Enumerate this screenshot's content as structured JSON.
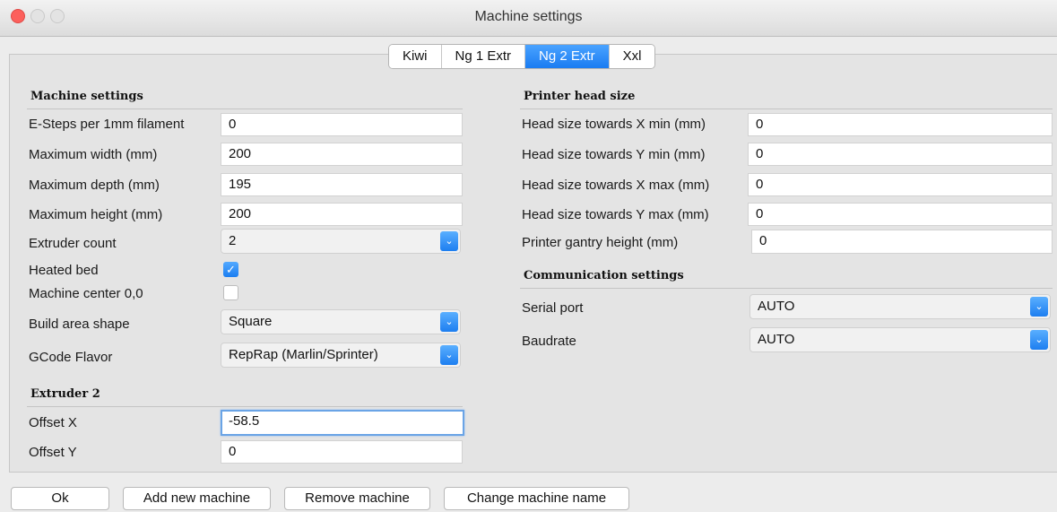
{
  "window": {
    "title": "Machine settings"
  },
  "tabs": [
    "Kiwi",
    "Ng 1 Extr",
    "Ng 2 Extr",
    "Xxl"
  ],
  "active_tab": "Ng 2 Extr",
  "machine": {
    "heading": "Machine settings",
    "esteps_label": "E-Steps per 1mm filament",
    "esteps_value": "0",
    "width_label": "Maximum width (mm)",
    "width_value": "200",
    "depth_label": "Maximum depth (mm)",
    "depth_value": "195",
    "height_label": "Maximum height (mm)",
    "height_value": "200",
    "extruder_label": "Extruder count",
    "extruder_value": "2",
    "heated_label": "Heated bed",
    "heated_checked": true,
    "center_label": "Machine center 0,0",
    "center_checked": false,
    "shape_label": "Build area shape",
    "shape_value": "Square",
    "gcode_label": "GCode Flavor",
    "gcode_value": "RepRap (Marlin/Sprinter)"
  },
  "extruder2": {
    "heading": "Extruder 2",
    "offx_label": "Offset X",
    "offx_value": "-58.5",
    "offy_label": "Offset Y",
    "offy_value": "0"
  },
  "head": {
    "heading": "Printer head size",
    "xmin_label": "Head size towards X min (mm)",
    "xmin_value": "0",
    "ymin_label": "Head size towards Y min (mm)",
    "ymin_value": "0",
    "xmax_label": "Head size towards X max (mm)",
    "xmax_value": "0",
    "ymax_label": "Head size towards Y max (mm)",
    "ymax_value": "0",
    "gantry_label": "Printer gantry height (mm)",
    "gantry_value": "0"
  },
  "comm": {
    "heading": "Communication settings",
    "serial_label": "Serial port",
    "serial_value": "AUTO",
    "baud_label": "Baudrate",
    "baud_value": "AUTO"
  },
  "buttons": {
    "ok": "Ok",
    "add": "Add new machine",
    "remove": "Remove machine",
    "rename": "Change machine name"
  },
  "icons": {
    "checkmark": "✓",
    "select_arrow": "⌄"
  },
  "colors": {
    "accent": "#1a7cf2",
    "close": "#fc605c"
  }
}
